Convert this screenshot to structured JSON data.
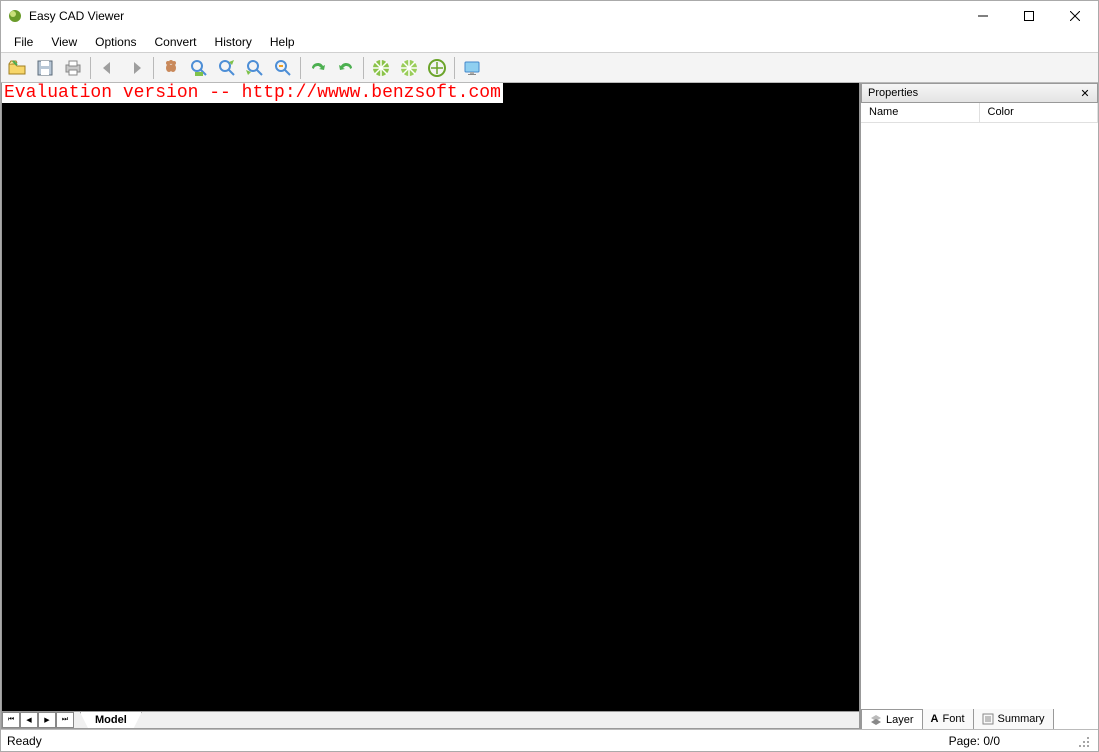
{
  "app": {
    "title": "Easy CAD Viewer"
  },
  "menubar": [
    "File",
    "View",
    "Options",
    "Convert",
    "History",
    "Help"
  ],
  "toolbar_groups": [
    [
      "open",
      "save",
      "print"
    ],
    [
      "back",
      "forward"
    ],
    [
      "pan",
      "zoom-in",
      "zoom-out",
      "zoom-extents",
      "zoom-window"
    ],
    [
      "redo",
      "undo"
    ],
    [
      "views-1",
      "views-2",
      "views-3"
    ],
    [
      "display"
    ]
  ],
  "canvas": {
    "eval_prefix": "Evaluation version -- ",
    "eval_url": "http://wwww.benzsoft.com"
  },
  "sheet": {
    "tabs": [
      "Model"
    ]
  },
  "properties": {
    "title": "Properties",
    "columns": [
      "Name",
      "Color"
    ],
    "tabs": [
      {
        "label": "Layer",
        "icon": "layer"
      },
      {
        "label": "Font",
        "icon": "font"
      },
      {
        "label": "Summary",
        "icon": "summary"
      }
    ]
  },
  "status": {
    "ready": "Ready",
    "page": "Page: 0/0"
  }
}
